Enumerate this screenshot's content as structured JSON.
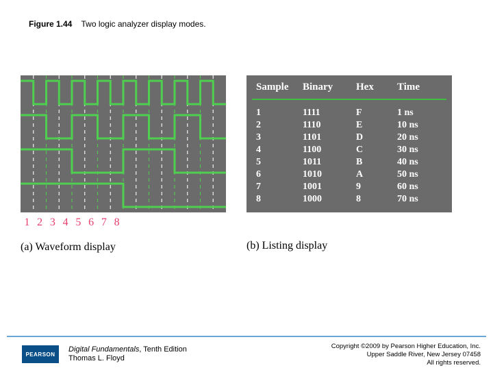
{
  "figure": {
    "number": "Figure 1.44",
    "title": "Two logic analyzer display modes."
  },
  "waveform": {
    "caption": "(a) Waveform display",
    "xlabels": [
      "1",
      "2",
      "3",
      "4",
      "5",
      "6",
      "7",
      "8"
    ],
    "n_samples": 16,
    "traces": [
      [
        1,
        0,
        1,
        0,
        1,
        0,
        1,
        0,
        1,
        0,
        1,
        0,
        1,
        0,
        1,
        0
      ],
      [
        1,
        1,
        0,
        0,
        1,
        1,
        0,
        0,
        1,
        1,
        0,
        0,
        1,
        1,
        0,
        0
      ],
      [
        1,
        1,
        1,
        1,
        0,
        0,
        0,
        0,
        1,
        1,
        1,
        1,
        0,
        0,
        0,
        0
      ],
      [
        1,
        1,
        1,
        1,
        1,
        1,
        1,
        1,
        0,
        0,
        0,
        0,
        0,
        0,
        0,
        0
      ]
    ]
  },
  "listing": {
    "caption": "(b) Listing display",
    "headers": {
      "sample": "Sample",
      "binary": "Binary",
      "hex": "Hex",
      "time": "Time"
    },
    "rows": [
      {
        "sample": "1",
        "binary": "1111",
        "hex": "F",
        "time": "1 ns"
      },
      {
        "sample": "2",
        "binary": "1110",
        "hex": "E",
        "time": "10 ns"
      },
      {
        "sample": "3",
        "binary": "1101",
        "hex": "D",
        "time": "20 ns"
      },
      {
        "sample": "4",
        "binary": "1100",
        "hex": "C",
        "time": "30 ns"
      },
      {
        "sample": "5",
        "binary": "1011",
        "hex": "B",
        "time": "40 ns"
      },
      {
        "sample": "6",
        "binary": "1010",
        "hex": "A",
        "time": "50 ns"
      },
      {
        "sample": "7",
        "binary": "1001",
        "hex": "9",
        "time": "60 ns"
      },
      {
        "sample": "8",
        "binary": "1000",
        "hex": "8",
        "time": "70 ns"
      }
    ]
  },
  "footer": {
    "publisher": "PEARSON",
    "book_title_italic": "Digital Fundamentals",
    "book_title_rest": ", Tenth Edition",
    "author": "Thomas L. Floyd",
    "copyright1": "Copyright ©2009 by Pearson Higher Education, Inc.",
    "copyright2": "Upper Saddle River, New Jersey 07458",
    "copyright3": "All rights reserved."
  },
  "chart_data": {
    "type": "table",
    "title": "Two logic analyzer display modes",
    "columns": [
      "Sample",
      "Binary",
      "Hex",
      "Time"
    ],
    "rows": [
      [
        "1",
        "1111",
        "F",
        "1 ns"
      ],
      [
        "2",
        "1110",
        "E",
        "10 ns"
      ],
      [
        "3",
        "1101",
        "D",
        "20 ns"
      ],
      [
        "4",
        "1100",
        "C",
        "30 ns"
      ],
      [
        "5",
        "1011",
        "B",
        "40 ns"
      ],
      [
        "6",
        "1010",
        "A",
        "50 ns"
      ],
      [
        "7",
        "1001",
        "9",
        "60 ns"
      ],
      [
        "8",
        "1000",
        "8",
        "70 ns"
      ]
    ]
  }
}
